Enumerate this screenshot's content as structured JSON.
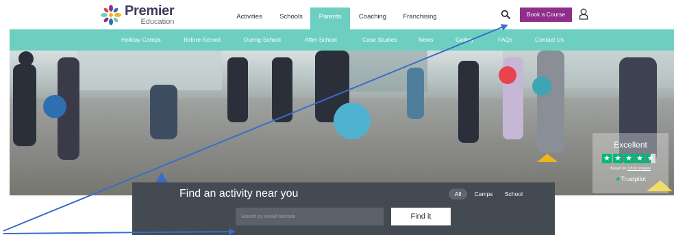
{
  "brand": {
    "name": "Premier",
    "sub": "Education",
    "colors": {
      "purple": "#8e2f8c",
      "teal": "#6ccfc0",
      "yellow": "#f3b41b",
      "blue": "#2f6fb0"
    }
  },
  "topnav": {
    "items": [
      {
        "label": "Activities",
        "active": false
      },
      {
        "label": "Schools",
        "active": false
      },
      {
        "label": "Parents",
        "active": true
      },
      {
        "label": "Coaching",
        "active": false
      },
      {
        "label": "Franchising",
        "active": false
      }
    ],
    "search_icon": "magnifier-icon",
    "book_label": "Book a Course",
    "user_icon": "user-icon"
  },
  "subnav": {
    "items": [
      {
        "label": "Holiday Camps"
      },
      {
        "label": "Before-School"
      },
      {
        "label": "During-School"
      },
      {
        "label": "After-School"
      },
      {
        "label": "Case Studies"
      },
      {
        "label": "News"
      },
      {
        "label": "Gallery"
      },
      {
        "label": "FAQs"
      },
      {
        "label": "Contact Us"
      }
    ]
  },
  "hero": {
    "image_icon": "children-playing-photo"
  },
  "trustpilot": {
    "rating_word": "Excellent",
    "based_prefix": "Based on ",
    "reviews": "3,830 reviews",
    "brand": "Trustpilot",
    "stars": 4.5,
    "star_color": "#00b67a"
  },
  "finder": {
    "title": "Find an activity near you",
    "filters": [
      {
        "label": "All",
        "active": true
      },
      {
        "label": "Camps",
        "active": false
      },
      {
        "label": "School",
        "active": false
      }
    ],
    "placeholder": "Search by Area/Postcode",
    "button_label": "Find it"
  }
}
